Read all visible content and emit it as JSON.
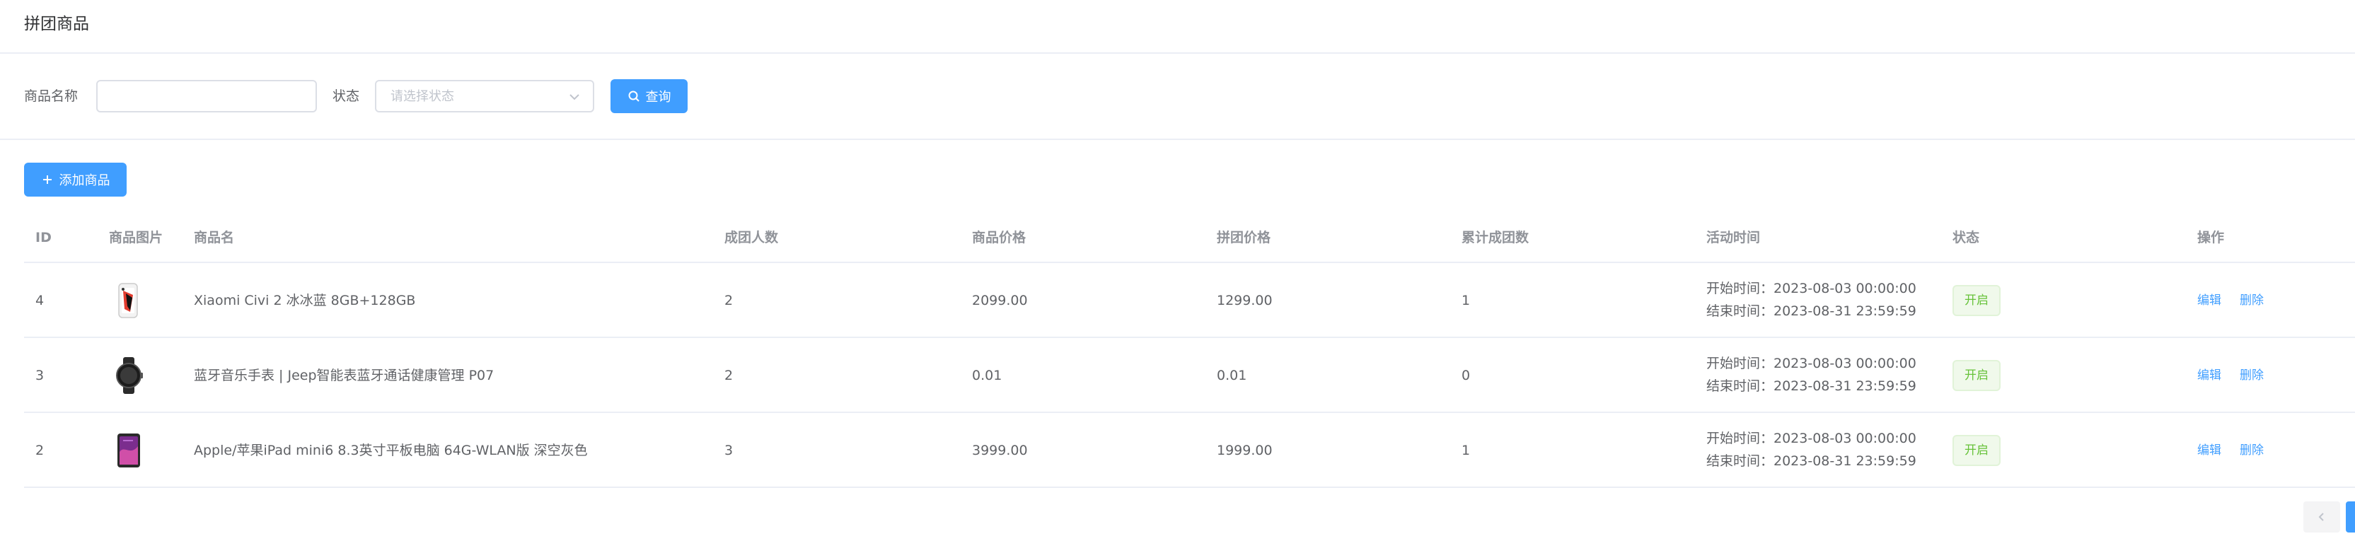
{
  "page": {
    "title": "拼团商品"
  },
  "filters": {
    "name_label": "商品名称",
    "name_value": "",
    "status_label": "状态",
    "status_placeholder": "请选择状态",
    "query_button": "查询"
  },
  "toolbar": {
    "add_button": "添加商品"
  },
  "table": {
    "columns": [
      "ID",
      "商品图片",
      "商品名",
      "成团人数",
      "商品价格",
      "拼团价格",
      "累计成团数",
      "活动时间",
      "状态",
      "操作"
    ],
    "rows": [
      {
        "id": "4",
        "image": "phone-image",
        "name": "Xiaomi Civi 2 冰冰蓝 8GB+128GB",
        "group_size": "2",
        "price": "2099.00",
        "group_price": "1299.00",
        "total_groups": "1",
        "start_time": "开始时间：2023-08-03 00:00:00",
        "end_time": "结束时间：2023-08-31 23:59:59",
        "status": "开启",
        "edit": "编辑",
        "delete": "删除"
      },
      {
        "id": "3",
        "image": "watch-image",
        "name": "蓝牙音乐手表 | Jeep智能表蓝牙通话健康管理 P07",
        "group_size": "2",
        "price": "0.01",
        "group_price": "0.01",
        "total_groups": "0",
        "start_time": "开始时间：2023-08-03 00:00:00",
        "end_time": "结束时间：2023-08-31 23:59:59",
        "status": "开启",
        "edit": "编辑",
        "delete": "删除"
      },
      {
        "id": "2",
        "image": "tablet-image",
        "name": "Apple/苹果iPad mini6 8.3英寸平板电脑 64G-WLAN版 深空灰色",
        "group_size": "3",
        "price": "3999.00",
        "group_price": "1999.00",
        "total_groups": "1",
        "start_time": "开始时间：2023-08-03 00:00:00",
        "end_time": "结束时间：2023-08-31 23:59:59",
        "status": "开启",
        "edit": "编辑",
        "delete": "删除"
      }
    ]
  },
  "colors": {
    "primary": "#409eff",
    "success_text": "#67c23a",
    "success_bg": "#f0f9eb",
    "border": "#ebeef5",
    "header_text": "#909399"
  },
  "icons": {
    "search": "search-icon",
    "plus": "plus-icon",
    "chevron": "chevron-down-icon",
    "prev": "chevron-left-icon"
  }
}
